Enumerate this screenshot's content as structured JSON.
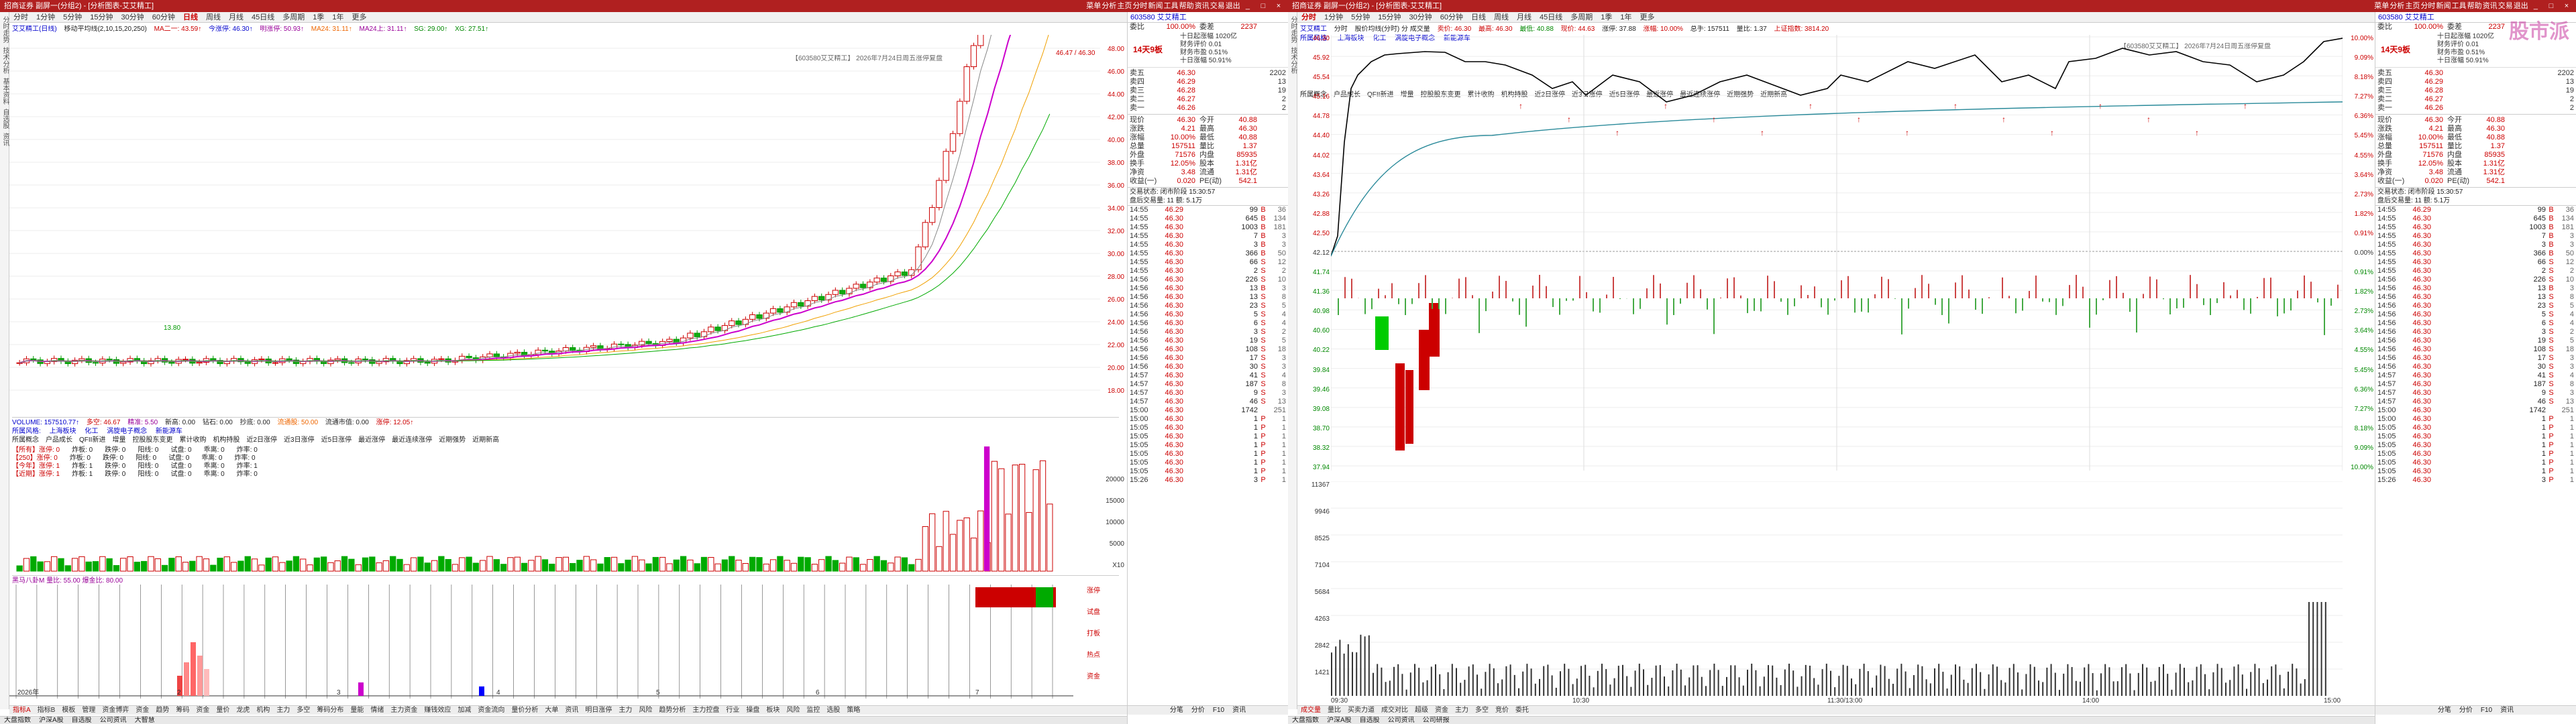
{
  "title": "招商证券 副屏一(分组2) - [分析图表-艾艾精工]",
  "left_toolbar": [
    "分时",
    "1分钟",
    "5分钟",
    "15分钟",
    "30分钟",
    "60分钟",
    "日线",
    "周线",
    "月线",
    "45日线",
    "多周期",
    "1季",
    "1年",
    "更多"
  ],
  "left_active": "日线",
  "left_strip": [
    "分时走势",
    "技术分析",
    "基本资料",
    "自选股",
    "资讯"
  ],
  "left_info": {
    "stock": "艾艾精工(日线)",
    "ma": "移动平均线(2,10,15,20,250)",
    "m1": "MA二一: 43.59↑",
    "m2": "今涨停: 46.30↑",
    "m3": "明涨停: 50.93↑",
    "m4": "MA24: 31.11↑",
    "m5": "MA24上: 31.11↑",
    "m6": "SG: 29.00↑",
    "m7": "XG: 27.51↑"
  },
  "left_chart_tag": "【603580艾艾精工】 2026年7月24日周五涨停复盘",
  "left_yaxis": [
    "48.00",
    "46.00",
    "44.00",
    "42.00",
    "40.00",
    "38.00",
    "36.00",
    "34.00",
    "32.00",
    "30.00",
    "28.00",
    "26.00",
    "24.00",
    "22.00",
    "20.00",
    "18.00"
  ],
  "left_hi_label": "46.47 / 46.30",
  "left_lo_label": "13.80",
  "left_vol_info": {
    "t": "VOLUME: 157510.77↑",
    "a": "多空: 46.67",
    "b": "精准: 5.50",
    "c": "新高: 0.00",
    "d": "钻石: 0.00",
    "e": "抄底: 0.00",
    "f": "流通股: 50.00",
    "g": "流通市值: 0.00",
    "h": "涨停: 12.05↑"
  },
  "left_vol_yaxis": [
    "20000",
    "15000",
    "10000",
    "5000",
    "X10"
  ],
  "left_sector": {
    "label": "所属风格:",
    "items": [
      "上海板块",
      "化工",
      "涡旋电子概念",
      "新能源车"
    ]
  },
  "left_sector2": [
    "所属概念",
    "户品成长",
    "QFII新进",
    "增量",
    "控股股东变更",
    "累计收购",
    "机构持股",
    "近2日涨停",
    "近3日涨停",
    "近5日涨停",
    "最近涨停",
    "最近连续涨停",
    "近期强势",
    "近期新高"
  ],
  "left_stats": [
    {
      "k": "【所有】涨停: 0",
      "v": "炸板: 0",
      "w": "跌停: 0",
      "x": "阳线: 0",
      "y": "试盘: 0",
      "z": "乖离: 0",
      "q": "炸率: 0"
    },
    {
      "k": "【250】涨停: 0",
      "v": "炸板: 0",
      "w": "跌停: 0",
      "x": "阳线: 0",
      "y": "试盘: 0",
      "z": "乖离: 0",
      "q": "炸率: 0"
    },
    {
      "k": "【今年】涨停: 1",
      "v": "炸板: 1",
      "w": "跌停: 0",
      "x": "阳线: 0",
      "y": "试盘: 0",
      "z": "乖离: 0",
      "q": "炸率: 1"
    },
    {
      "k": "【近期】涨停: 1",
      "v": "炸板: 1",
      "w": "跌停: 0",
      "x": "阳线: 0",
      "y": "试盘: 0",
      "z": "乖离: 0",
      "q": "炸率: 0"
    }
  ],
  "left_ind_info": "黑马八卦M  量比: 55.00  爆金比: 80.00",
  "left_ind_side": [
    "涨停",
    "试盘",
    "打板",
    "热点",
    "资金"
  ],
  "left_date_labels": [
    "2026年",
    "2",
    "3",
    "4",
    "5",
    "6",
    "7"
  ],
  "left_bottom_tabs": [
    "指标A",
    "指标B",
    "模板",
    "管理",
    "资金博弈",
    "资金",
    "趋势",
    "筹码",
    "资金",
    "量价",
    "龙虎",
    "机构",
    "主力",
    "多空",
    "筹码分布",
    "量能",
    "情绪",
    "主力资金",
    "赚钱效应",
    "加减",
    "资金流向",
    "量价分析",
    "大单",
    "资讯",
    "明日涨停",
    "主力",
    "风险",
    "趋势分析",
    "主力控盘",
    "行业",
    "操盘",
    "板块",
    "风险",
    "监控",
    "选股",
    "策略"
  ],
  "left_status": [
    "大盘指数",
    "沪深A股",
    "自选股",
    "公司资讯",
    "大智慧"
  ],
  "left_quote": {
    "code": "603580 艾艾精工",
    "weibi": "100.00%",
    "weicha": "2237",
    "tag": "14天9板",
    "info_lines": [
      "十日起涨幅 1020亿",
      "财务评价 0.01",
      "财务市盈 0.51%",
      "十日涨幅 50.91%"
    ],
    "sell": [
      [
        "卖五",
        "46.30",
        "2202"
      ],
      [
        "卖四",
        "46.29",
        "13"
      ],
      [
        "卖三",
        "46.28",
        "19"
      ],
      [
        "卖二",
        "46.27",
        "2"
      ],
      [
        "卖一",
        "46.26",
        "2"
      ]
    ],
    "buy_rows": [
      [
        "现价",
        "46.30",
        "今开",
        "40.88"
      ],
      [
        "涨跌",
        "4.21",
        "最高",
        "46.30"
      ],
      [
        "涨幅",
        "10.00%",
        "最低",
        "40.88"
      ],
      [
        "总量",
        "157511",
        "量比",
        "1.37"
      ],
      [
        "外盘",
        "71576",
        "内盘",
        "85935"
      ],
      [
        "换手",
        "12.05%",
        "股本",
        "1.31亿"
      ],
      [
        "净资",
        "3.48",
        "流通",
        "1.31亿"
      ],
      [
        "收益(一)",
        "0.020",
        "PE(动)",
        "542.1"
      ]
    ],
    "time_status": "交易状态: 闭市阶段 15:30:57",
    "summary": "盘后交易量: 11 额: 5.1万",
    "ticks": [
      [
        "14:55",
        "46.29",
        "99",
        "B",
        "36"
      ],
      [
        "14:55",
        "46.30",
        "645",
        "B",
        "134"
      ],
      [
        "14:55",
        "46.30",
        "1003",
        "B",
        "181"
      ],
      [
        "14:55",
        "46.30",
        "7",
        "B",
        "3"
      ],
      [
        "14:55",
        "46.30",
        "3",
        "B",
        "3"
      ],
      [
        "14:55",
        "46.30",
        "366",
        "B",
        "50"
      ],
      [
        "14:55",
        "46.30",
        "66",
        "S",
        "12"
      ],
      [
        "14:55",
        "46.30",
        "2",
        "S",
        "2"
      ],
      [
        "14:56",
        "46.30",
        "226",
        "S",
        "10"
      ],
      [
        "14:56",
        "46.30",
        "13",
        "B",
        "3"
      ],
      [
        "14:56",
        "46.30",
        "13",
        "S",
        "8"
      ],
      [
        "14:56",
        "46.30",
        "23",
        "S",
        "5"
      ],
      [
        "14:56",
        "46.30",
        "5",
        "S",
        "4"
      ],
      [
        "14:56",
        "46.30",
        "6",
        "S",
        "4"
      ],
      [
        "14:56",
        "46.30",
        "3",
        "S",
        "2"
      ],
      [
        "14:56",
        "46.30",
        "19",
        "S",
        "5"
      ],
      [
        "14:56",
        "46.30",
        "108",
        "S",
        "18"
      ],
      [
        "14:56",
        "46.30",
        "17",
        "S",
        "3"
      ],
      [
        "14:56",
        "46.30",
        "30",
        "S",
        "3"
      ],
      [
        "14:57",
        "46.30",
        "41",
        "S",
        "4"
      ],
      [
        "14:57",
        "46.30",
        "187",
        "S",
        "8"
      ],
      [
        "14:57",
        "46.30",
        "9",
        "S",
        "3"
      ],
      [
        "14:57",
        "46.30",
        "46",
        "S",
        "13"
      ],
      [
        "15:00",
        "46.30",
        "1742",
        "",
        "251"
      ],
      [
        "15:00",
        "46.30",
        "1",
        "P",
        "1"
      ],
      [
        "15:05",
        "46.30",
        "1",
        "P",
        "1"
      ],
      [
        "15:05",
        "46.30",
        "1",
        "P",
        "1"
      ],
      [
        "15:05",
        "46.30",
        "1",
        "P",
        "1"
      ],
      [
        "15:05",
        "46.30",
        "1",
        "P",
        "1"
      ],
      [
        "15:05",
        "46.30",
        "1",
        "P",
        "1"
      ],
      [
        "15:05",
        "46.30",
        "1",
        "P",
        "1"
      ],
      [
        "15:26",
        "46.30",
        "3",
        "P",
        "1"
      ]
    ],
    "btns": [
      "分笔",
      "分价",
      "F10",
      "资讯"
    ]
  },
  "right_title": "招商证券 副屏一(分组2) - [分析图表-艾艾精工]",
  "right_toolbar": [
    "分时",
    "1分钟",
    "5分钟",
    "15分钟",
    "30分钟",
    "60分钟",
    "日线",
    "周线",
    "月线",
    "45日线",
    "多周期",
    "1季",
    "1年",
    "更多"
  ],
  "right_active": "分时",
  "right_info": {
    "a": "艾艾精工",
    "b": "分时",
    "c": "股价均线(分时) 分 成交量",
    "d": "卖价: 46.30",
    "e": "最高: 46.30",
    "f": "最低: 40.88",
    "g": "现价: 44.63",
    "h": "涨停: 37.88",
    "i": "涨幅: 10.00%",
    "j": "总手: 157511",
    "k": "量比: 1.37",
    "l": "上证指数: 3814.20"
  },
  "right_chart_tag": "【603580艾艾精工】 2026年7月24日周五涨停复盘",
  "right_yaxis_l": [
    "46.30",
    "45.92",
    "45.54",
    "45.16",
    "44.78",
    "44.40",
    "44.02",
    "43.64",
    "43.26",
    "42.88",
    "42.50",
    "42.12",
    "41.74",
    "41.36",
    "40.98",
    "40.60",
    "40.22",
    "39.84",
    "39.46",
    "39.08",
    "38.70",
    "38.32",
    "37.94"
  ],
  "right_yaxis_r": [
    "10.00%",
    "9.09%",
    "8.18%",
    "7.27%",
    "6.36%",
    "5.45%",
    "4.55%",
    "3.64%",
    "2.73%",
    "1.82%",
    "0.91%",
    "0.00%",
    "0.91%",
    "1.82%",
    "2.73%",
    "3.64%",
    "4.55%",
    "5.45%",
    "6.36%",
    "7.27%",
    "8.18%",
    "9.09%",
    "10.00%"
  ],
  "right_vol_yaxis": [
    "11367",
    "9946",
    "8525",
    "7104",
    "5684",
    "4263",
    "2842",
    "1421"
  ],
  "right_time_labels": [
    "09:30",
    "10:30",
    "11:30/13:00",
    "14:00",
    "15:00"
  ],
  "right_sector": {
    "label": "所属风格:",
    "items": [
      "上海板块",
      "化工",
      "涡旋电子概念",
      "新能源车"
    ]
  },
  "right_sector2": [
    "所属概念",
    "户品成长",
    "QFII新进",
    "增量",
    "控股股东变更",
    "累计收购",
    "机构持股",
    "近2日涨停",
    "近3日涨停",
    "近5日涨停",
    "最近涨停",
    "最近连续涨停",
    "近期强势",
    "近期新高"
  ],
  "right_bottom_tabs": [
    "成交量",
    "量比",
    "买卖力道",
    "成交对比",
    "超级",
    "资金",
    "主力",
    "多空",
    "竞价",
    "委托"
  ],
  "right_status": [
    "大盘指数",
    "沪深A股",
    "自选股",
    "公司资讯",
    "公司研报"
  ],
  "right_quote": {
    "code": "603580 艾艾精工",
    "weibi": "100.00%",
    "weicha": "2237",
    "tag": "14天9板",
    "info_lines": [
      "十日起涨幅 1020亿",
      "财务评价 0.01",
      "财务市盈 0.51%",
      "十日涨幅 50.91%"
    ],
    "sell": [
      [
        "卖五",
        "46.30",
        "2202"
      ],
      [
        "卖四",
        "46.29",
        "13"
      ],
      [
        "卖三",
        "46.28",
        "19"
      ],
      [
        "卖二",
        "46.27",
        "2"
      ],
      [
        "卖一",
        "46.26",
        "2"
      ]
    ],
    "buy_rows": [
      [
        "现价",
        "46.30",
        "今开",
        "40.88"
      ],
      [
        "涨跌",
        "4.21",
        "最高",
        "46.30"
      ],
      [
        "涨幅",
        "10.00%",
        "最低",
        "40.88"
      ],
      [
        "总量",
        "157511",
        "量比",
        "1.37"
      ],
      [
        "外盘",
        "71576",
        "内盘",
        "85935"
      ],
      [
        "换手",
        "12.05%",
        "股本",
        "1.31亿"
      ],
      [
        "净资",
        "3.48",
        "流通",
        "1.31亿"
      ],
      [
        "收益(一)",
        "0.020",
        "PE(动)",
        "542.1"
      ]
    ],
    "time_status": "交易状态: 闭市阶段 15:30:57",
    "summary": "盘后交易量: 11 额: 5.1万",
    "btns": [
      "分笔",
      "分价",
      "F10",
      "资讯"
    ]
  },
  "top_menu": [
    "菜单",
    "分析",
    "主页",
    "分时",
    "新闻",
    "工具",
    "帮助",
    "资讯",
    "交易",
    "退出"
  ],
  "watermark": "股市派",
  "colors": {
    "red": "#cc0000",
    "green": "#00aa00",
    "title": "#b02020",
    "accent_purple": "#b000b0"
  }
}
